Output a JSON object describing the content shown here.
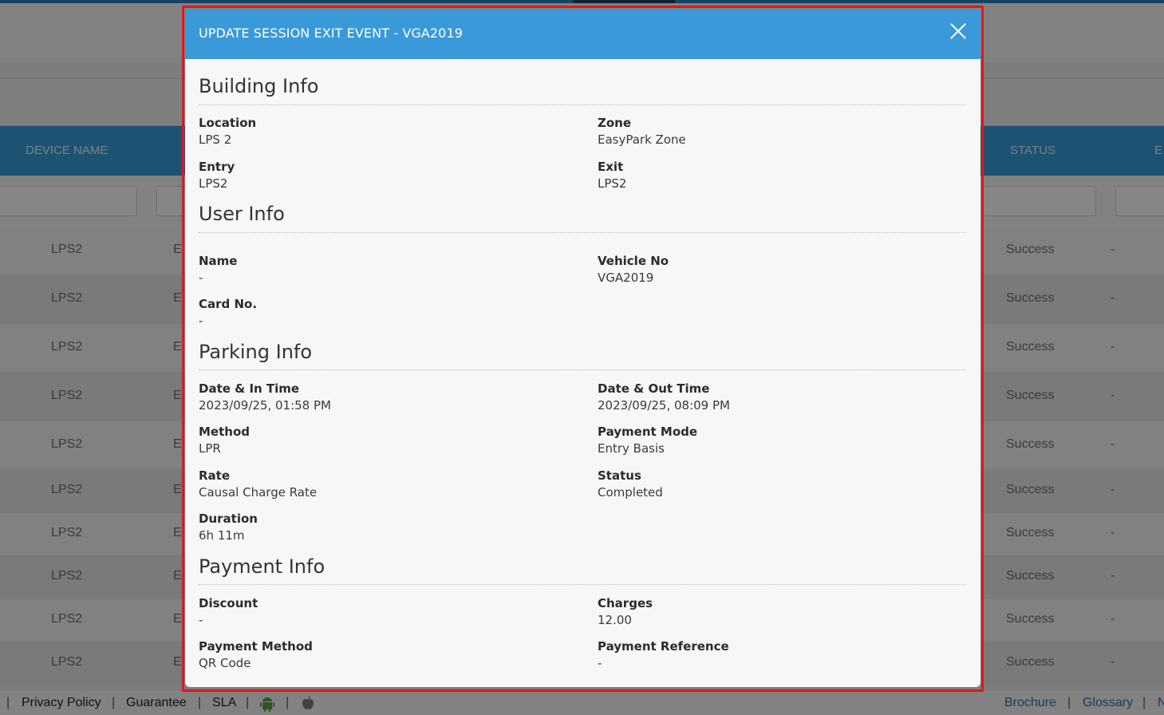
{
  "background": {
    "table_headers": [
      "DEVICE NAME",
      "STATUS",
      "E"
    ],
    "rows": [
      {
        "device": "LPS2",
        "col2": "E",
        "status": "Success",
        "extra": "-"
      },
      {
        "device": "LPS2",
        "col2": "E",
        "status": "Success",
        "extra": "-"
      },
      {
        "device": "LPS2",
        "col2": "E",
        "status": "Success",
        "extra": "-"
      },
      {
        "device": "LPS2",
        "col2": "E",
        "status": "Success",
        "extra": "-"
      },
      {
        "device": "LPS2",
        "col2": "E",
        "status": "Success",
        "extra": "-"
      },
      {
        "device": "LPS2",
        "col2": "E",
        "status": "Success",
        "extra": "-"
      },
      {
        "device": "LPS2",
        "col2": "E",
        "status": "Success",
        "extra": "-"
      },
      {
        "device": "LPS2",
        "col2": "E",
        "status": "Success",
        "extra": "-"
      },
      {
        "device": "LPS2",
        "col2": "E",
        "status": "Success",
        "extra": "-"
      },
      {
        "device": "LPS2",
        "col2": "E",
        "status": "Success",
        "extra": "-"
      }
    ],
    "footer": {
      "sep": "|",
      "privacy": "Privacy Policy",
      "guarantee": "Guarantee",
      "sla": "SLA",
      "brochure": "Brochure",
      "glossary": "Glossary",
      "last": "N"
    }
  },
  "modal": {
    "title": "UPDATE SESSION EXIT EVENT - VGA2019",
    "sections": {
      "building": {
        "title": "Building Info",
        "location": {
          "label": "Location",
          "value": "LPS 2"
        },
        "zone": {
          "label": "Zone",
          "value": "EasyPark Zone"
        },
        "entry": {
          "label": "Entry",
          "value": "LPS2"
        },
        "exit": {
          "label": "Exit",
          "value": "LPS2"
        }
      },
      "user": {
        "title": "User Info",
        "name": {
          "label": "Name",
          "value": "-"
        },
        "vehicle": {
          "label": "Vehicle No",
          "value": "VGA2019"
        },
        "card": {
          "label": "Card No.",
          "value": "-"
        }
      },
      "parking": {
        "title": "Parking Info",
        "in_time": {
          "label": "Date & In Time",
          "value": "2023/09/25, 01:58 PM"
        },
        "out_time": {
          "label": "Date & Out Time",
          "value": "2023/09/25, 08:09 PM"
        },
        "method": {
          "label": "Method",
          "value": "LPR"
        },
        "payment_mode": {
          "label": "Payment Mode",
          "value": "Entry Basis"
        },
        "rate": {
          "label": "Rate",
          "value": "Causal Charge Rate"
        },
        "status": {
          "label": "Status",
          "value": "Completed"
        },
        "duration": {
          "label": "Duration",
          "value": "6h 11m"
        }
      },
      "payment": {
        "title": "Payment Info",
        "discount": {
          "label": "Discount",
          "value": "-"
        },
        "charges": {
          "label": "Charges",
          "value": "12.00"
        },
        "payment_method": {
          "label": "Payment Method",
          "value": "QR Code"
        },
        "payment_reference": {
          "label": "Payment Reference",
          "value": "-"
        }
      }
    }
  },
  "colors": {
    "modal_header": "#3a9ad9",
    "highlight_border": "#e3161c",
    "table_header": "#3795d1"
  },
  "icons": [
    "close-icon",
    "android-icon",
    "apple-icon"
  ]
}
